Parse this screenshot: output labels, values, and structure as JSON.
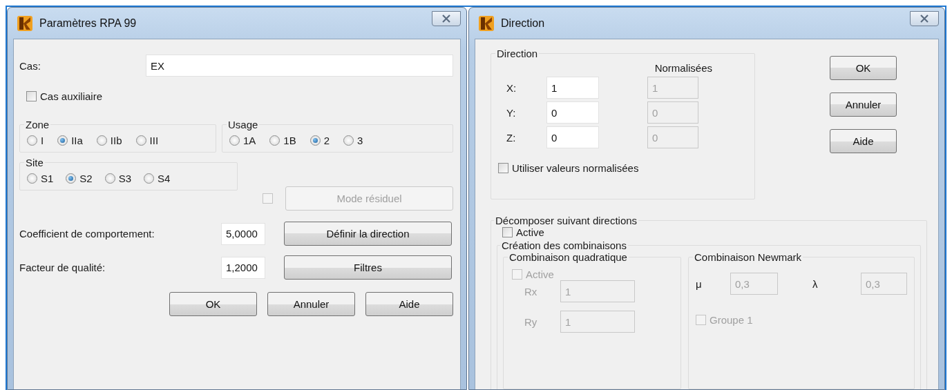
{
  "rpa_dialog": {
    "title": "Paramètres RPA 99",
    "cas": {
      "label": "Cas:",
      "value": "EX"
    },
    "cas_auxiliaire": {
      "label": "Cas auxiliaire",
      "checked": false
    },
    "zone": {
      "title": "Zone",
      "options": [
        {
          "label": "I",
          "selected": false
        },
        {
          "label": "IIa",
          "selected": true
        },
        {
          "label": "IIb",
          "selected": false
        },
        {
          "label": "III",
          "selected": false
        }
      ]
    },
    "usage": {
      "title": "Usage",
      "options": [
        {
          "label": "1A",
          "selected": false
        },
        {
          "label": "1B",
          "selected": false
        },
        {
          "label": "2",
          "selected": true
        },
        {
          "label": "3",
          "selected": false
        }
      ]
    },
    "site": {
      "title": "Site",
      "options": [
        {
          "label": "S1",
          "selected": false
        },
        {
          "label": "S2",
          "selected": true
        },
        {
          "label": "S3",
          "selected": false
        },
        {
          "label": "S4",
          "selected": false
        }
      ]
    },
    "mode_residuel": {
      "label": "Mode résiduel",
      "checked": false,
      "disabled": true
    },
    "coefficient": {
      "label": "Coefficient de comportement:",
      "value": "5,0000",
      "button": "Définir la direction"
    },
    "facteur": {
      "label": "Facteur de qualité:",
      "value": "1,2000",
      "button": "Filtres"
    },
    "buttons": [
      "OK",
      "Annuler",
      "Aide"
    ]
  },
  "direction_dialog": {
    "title": "Direction",
    "direction_group": {
      "title": "Direction",
      "normalized_header": "Normalisées",
      "normalized_disabled": true,
      "rows": [
        {
          "axis": "X:",
          "value": "1",
          "normalized": "1"
        },
        {
          "axis": "Y:",
          "value": "0",
          "normalized": "0"
        },
        {
          "axis": "Z:",
          "value": "0",
          "normalized": "0"
        }
      ]
    },
    "use_normalized": {
      "label": "Utiliser valeurs normalisées",
      "checked": false
    },
    "buttons": [
      "OK",
      "Annuler",
      "Aide"
    ],
    "decompose": {
      "title": "Décomposer suivant directions",
      "active": {
        "label": "Active",
        "checked": false
      },
      "creation": {
        "title": "Création des combinaisons",
        "quadratic": {
          "title": "Combinaison quadratique",
          "disabled": true,
          "active": {
            "label": "Active",
            "checked": false
          },
          "rows": [
            {
              "label": "Rx",
              "value": "1"
            },
            {
              "label": "Ry",
              "value": "1"
            }
          ]
        },
        "newmark": {
          "title": "Combinaison Newmark",
          "disabled": true,
          "mu": {
            "symbol": "μ",
            "value": "0,3"
          },
          "lambda": {
            "symbol": "λ",
            "value": "0,3"
          },
          "groups": [
            {
              "label": "Groupe 1",
              "checked": false
            }
          ]
        }
      }
    }
  }
}
